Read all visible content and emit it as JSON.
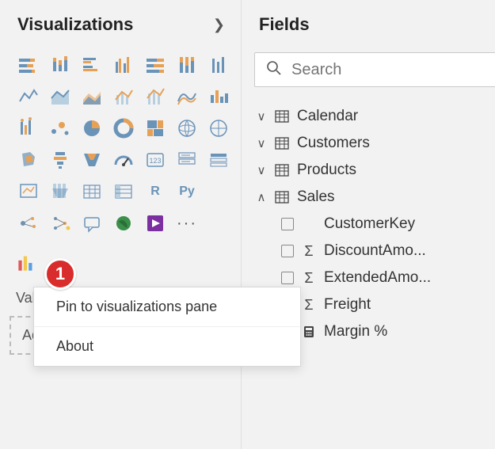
{
  "viz": {
    "title": "Visualizations",
    "more": "···",
    "r_label": "R",
    "py_label": "Py",
    "context": {
      "pin": "Pin to visualizations pane",
      "about": "About"
    },
    "callout": "1",
    "values_label": "Values",
    "drop_hint": "Add data fields here"
  },
  "fields": {
    "title": "Fields",
    "search_placeholder": "Search",
    "tables": {
      "calendar": {
        "label": "Calendar",
        "expanded": false
      },
      "customers": {
        "label": "Customers",
        "expanded": false
      },
      "products": {
        "label": "Products",
        "expanded": false
      },
      "sales": {
        "label": "Sales",
        "expanded": true,
        "fields": {
          "customerkey": {
            "label": "CustomerKey",
            "agg": ""
          },
          "discountamo": {
            "label": "DiscountAmo...",
            "agg": "Σ"
          },
          "extendedamo": {
            "label": "ExtendedAmo...",
            "agg": "Σ"
          },
          "freight": {
            "label": "Freight",
            "agg": "Σ"
          },
          "marginpct": {
            "label": "Margin %",
            "agg": "calc"
          }
        }
      }
    }
  }
}
